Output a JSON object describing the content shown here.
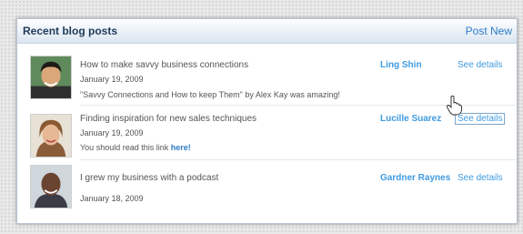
{
  "header": {
    "title": "Recent blog posts",
    "post_new": "Post New"
  },
  "posts": [
    {
      "title": "How to make savvy business connections",
      "date": "January 19, 2009",
      "note": "\"Savvy Connections and How to keep Them\" by Alex Kay was amazing!",
      "author": "Ling Shin",
      "details": "See details"
    },
    {
      "title": "Finding inspiration for new sales techniques",
      "date": "January 19, 2009",
      "note_prefix": "You should read this link ",
      "note_link": "here!",
      "author": "Lucille Suarez",
      "details": "See details"
    },
    {
      "title": "I grew my business with a podcast",
      "date": "January 18, 2009",
      "author": "Gardner Raynes",
      "details": "See details"
    }
  ],
  "colors": {
    "accent": "#3f9be0",
    "header_text": "#1f3b5a"
  }
}
